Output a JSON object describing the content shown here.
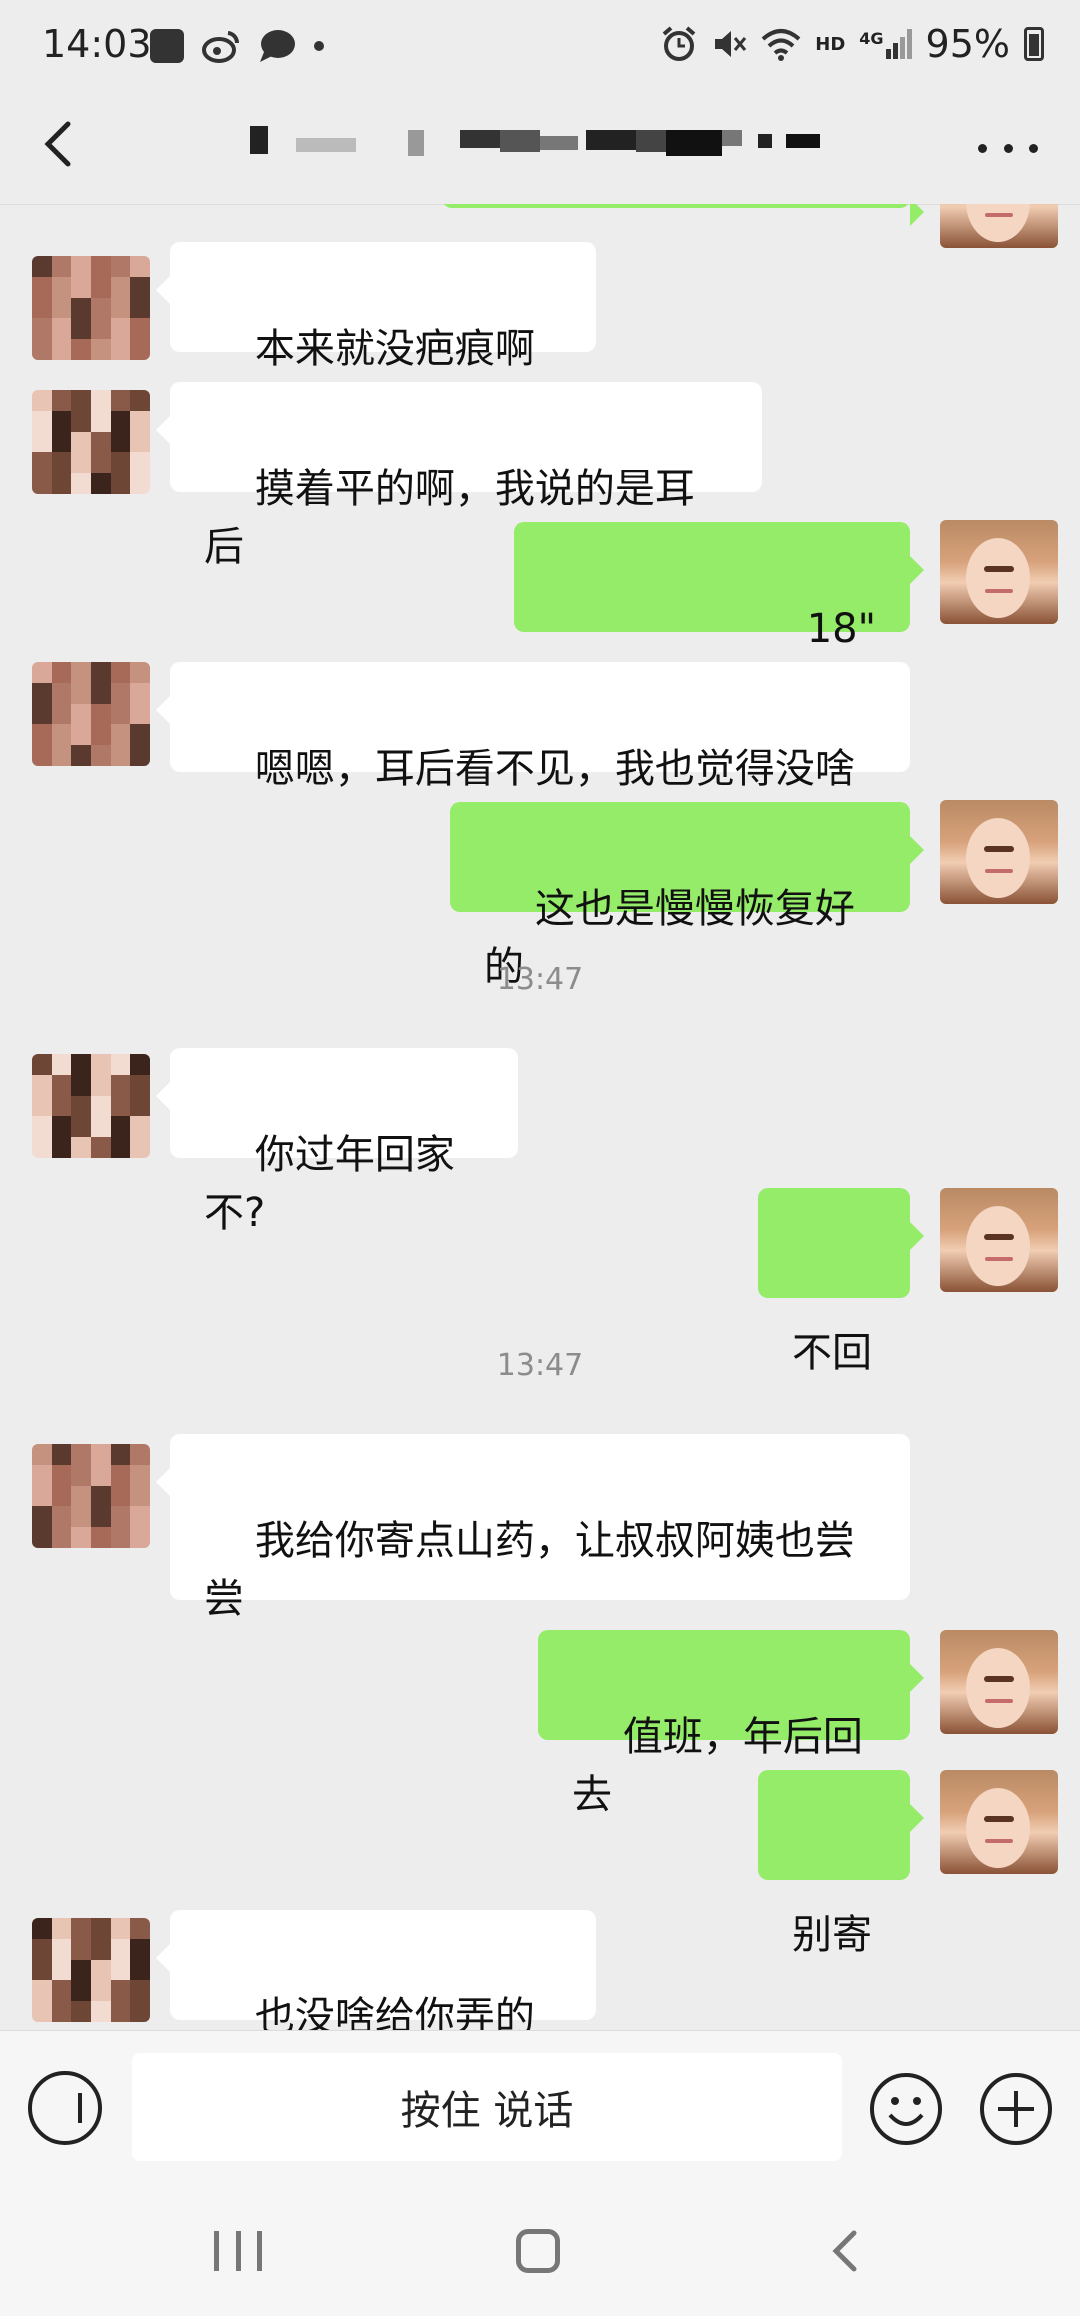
{
  "status_bar": {
    "time": "14:03",
    "battery": "95%",
    "network": "4G",
    "hd": "HD",
    "icons": [
      "gallery-icon",
      "weibo-icon",
      "chat-icon",
      "dot-icon",
      "alarm-icon",
      "mute-icon",
      "wifi-icon",
      "signal-icon",
      "battery-icon"
    ]
  },
  "header": {
    "back_icon": "chevron-left-icon",
    "more_icon": "more-horizontal-icon"
  },
  "messages": [
    {
      "side": "in",
      "text": "本来就没疤痕啊",
      "emoji": "laughing-tears-emoji"
    },
    {
      "side": "in",
      "text": "摸着平的啊，我说的是耳后"
    },
    {
      "side": "out",
      "voice": "18\"",
      "voice_icon": "voice-wave-icon"
    },
    {
      "side": "in",
      "text": "嗯嗯，耳后看不见，我也觉得没啥"
    },
    {
      "side": "out",
      "text": "这也是慢慢恢复好的"
    },
    {
      "time": "13:47"
    },
    {
      "side": "in",
      "text": "你过年回家不?"
    },
    {
      "side": "out",
      "text": "不回"
    },
    {
      "time": "13:47"
    },
    {
      "side": "in",
      "text": "我给你寄点山药，让叔叔阿姨也尝\n尝"
    },
    {
      "side": "out",
      "text": "值班，年后回去"
    },
    {
      "side": "out",
      "text": "别寄"
    },
    {
      "side": "in",
      "text": "也没啥给你弄的",
      "emoji": "laughing-tears-emoji"
    }
  ],
  "input_bar": {
    "hold_to_talk": "按住 说话",
    "voice_icon": "voice-input-icon",
    "emoji_icon": "emoji-icon",
    "plus_icon": "plus-icon"
  },
  "colors": {
    "outgoing_bubble": "#95ec69",
    "incoming_bubble": "#ffffff",
    "background": "#ededed"
  }
}
